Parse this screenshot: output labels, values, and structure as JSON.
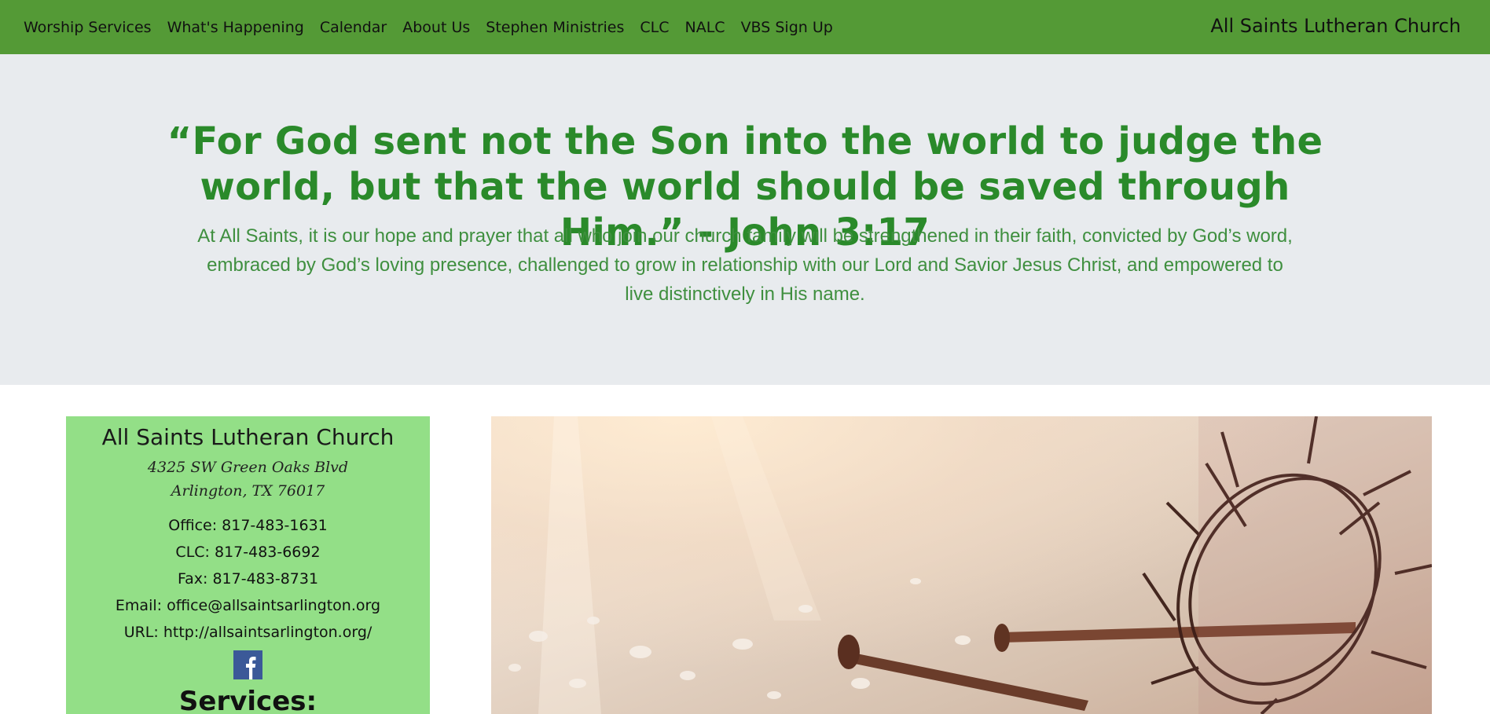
{
  "nav": {
    "links": [
      "Worship Services",
      "What's Happening",
      "Calendar",
      "About Us",
      "Stephen Ministries",
      "CLC",
      "NALC",
      "VBS Sign Up"
    ],
    "brand": "All Saints Lutheran Church"
  },
  "hero": {
    "quote": "“For God sent not the Son into the world to judge the world, but that the world should be saved through Him.” - John 3:17",
    "mission": "At All Saints, it is our hope and prayer that all who join our church family will be strengthened in their faith, convicted by God’s word, embraced by God’s loving presence, challenged to grow in relationship with our Lord and Savior Jesus Christ, and empowered to live distinctively in His name."
  },
  "info": {
    "name": "All Saints Lutheran Church",
    "address_line1": "4325 SW Green Oaks Blvd",
    "address_line2": "Arlington, TX 76017",
    "office": "Office: 817-483-1631",
    "clc": "CLC: 817-483-6692",
    "fax": "Fax: 817-483-8731",
    "email": "Email: office@allsaintsarlington.org",
    "url": "URL: http://allsaintsarlington.org/",
    "services_heading": "Services:"
  },
  "colors": {
    "nav_bg": "#549a36",
    "hero_bg": "#e8ebee",
    "accent_green": "#2a8a2a",
    "card_bg": "#93df87",
    "facebook_blue": "#3b5998"
  },
  "icons": {
    "facebook": "facebook-icon"
  }
}
